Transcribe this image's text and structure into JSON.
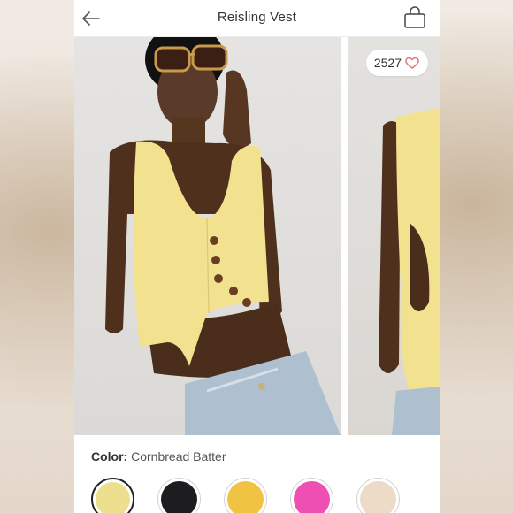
{
  "header": {
    "title": "Reisling Vest",
    "back_icon": "arrow-left-icon",
    "bag_icon": "shopping-bag-icon"
  },
  "gallery": {
    "like_count": "2527",
    "like_icon": "heart-icon",
    "heart_color": "#e8706f"
  },
  "color": {
    "label": "Color:",
    "value": "Cornbread Batter",
    "swatches": [
      {
        "name": "cornbread-batter",
        "hex": "#ece08f",
        "selected": true
      },
      {
        "name": "black",
        "hex": "#1d1d1f",
        "selected": false
      },
      {
        "name": "golden-yellow",
        "hex": "#f0c442",
        "selected": false
      },
      {
        "name": "pink",
        "hex": "#ee4fb3",
        "selected": false
      },
      {
        "name": "cream",
        "hex": "#ecdcc7",
        "selected": false
      }
    ]
  }
}
